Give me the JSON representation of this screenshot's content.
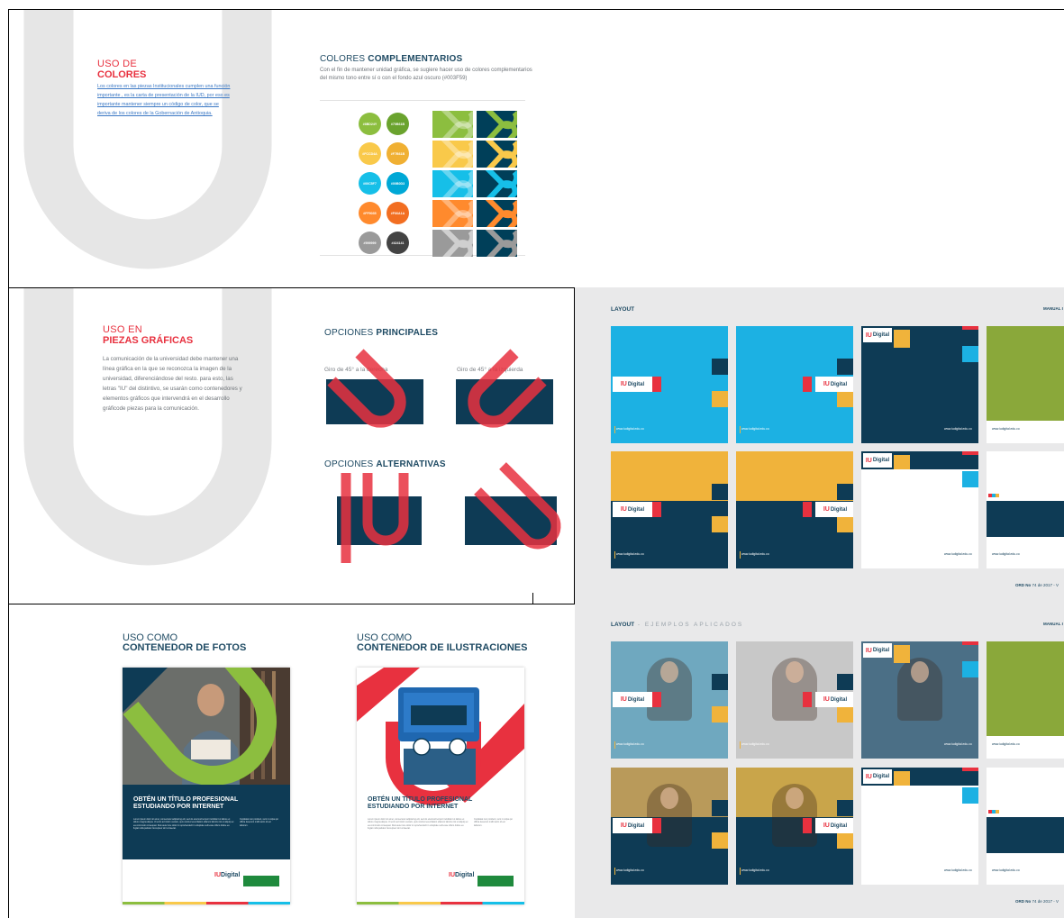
{
  "colores": {
    "title_thin": "USO DE",
    "title_bold": "COLORES",
    "paragraph": "Los colores en las piezas Institucionales cumplen una función importante , es la carta de presentación de la IUD, por eso es importante mantener siempre un código de color, que se deriva de los colores de la Gobernación de Antioquia."
  },
  "complementarios": {
    "title_thin": "COLORES ",
    "title_bold": "COMPLEMENTARIOS",
    "description": "Con el fin de mantener unidad gráfica, se sugiere hacer uso de colores complementarios del mismo tono entre sí o con el fondo azul oscuro (#003F59)",
    "swatches": [
      {
        "code": "#8BD24Y",
        "color": "#8cbe3f"
      },
      {
        "code": "#70B61B",
        "color": "#6aa32e"
      },
      {
        "code": "#FCCD4A",
        "color": "#f9c94a"
      },
      {
        "code": "#F7B61B",
        "color": "#f0b033"
      },
      {
        "code": "#00C5F7",
        "color": "#16bfe8"
      },
      {
        "code": "#00B0D3",
        "color": "#00a8d6"
      },
      {
        "code": "#FF9035",
        "color": "#ff8a2d"
      },
      {
        "code": "#F66A1A",
        "color": "#f26e21"
      },
      {
        "code": "#999999",
        "color": "#9a9a9a"
      },
      {
        "code": "#424141",
        "color": "#434343"
      }
    ],
    "tile_colors": [
      "#8cbe3f",
      "#f9c94a",
      "#16bfe8",
      "#ff8a2d",
      "#9a9a9a"
    ],
    "dark_color": "#003f59"
  },
  "piezas": {
    "title_thin": "USO EN",
    "title_bold": "PIEZAS GRÁFICAS",
    "paragraph": "La comunicación de la universidad debe mantener una línea gráfica en la que se reconozca la imagen de la universidad, diferenciándose del resto. para esto, las letras \"IU\" del distintivo, se usarán como contenedores y elementos gráficos que intervendrá en el desarrollo gráficode piezas para la comunicación.",
    "principales_thin": "OPCIONES ",
    "principales_bold": "PRINCIPALES",
    "caption_right": "Giro de 45° a la derecha",
    "caption_left": "Giro de 45° a la izquierda",
    "alternativas_thin": "OPCIONES ",
    "alternativas_bold": "ALTERNATIVAS"
  },
  "posters": {
    "fotos_thin": "USO COMO",
    "fotos_bold": "CONTENEDOR DE  FOTOS",
    "ilus_thin": "USO COMO",
    "ilus_bold": "CONTENEDOR DE  ILUSTRACIONES",
    "headline_1": "OBTÉN UN TÍTULO PROFESIONAL",
    "headline_2": "ESTUDIANDO POR INTERNET",
    "lorem": "Lorem ipsum dolor sit amet, consectetur adipiscing elit, sed do eiusmod tempor incididunt ut labore et dolore magna aliqua. Ut enim ad minim veniam, quis nostrud exercitation ullamco laboris nisi ut aliquip ex ea commodo consequat. Duis aute irure dolor in reprehenderit in voluptate velit esse cillum dolore eu fugiat nulla pariatur. Excepteur sint occaecat.",
    "lorem_side": "Cupidatat non proident, sunt in culpa qui officia deserunt mollit anim id est laborum.",
    "logo_iu": "IU",
    "logo_text": "Digital"
  },
  "layout": {
    "title": "LAYOUT",
    "manual": "MANUAL I",
    "title2": "LAYOUT",
    "title2_sub": " - EJEMPLOS APLICADOS",
    "manual2": "MANUAL I",
    "ord": "ORD No",
    "ord_rest": " 74 de 2017 - V",
    "ord2": "ORD No",
    "ord2_rest": " 74 de 2017 - V",
    "url": "www.iudigital.edu.co",
    "logo_iu": "IU",
    "logo_text": "Digital"
  }
}
